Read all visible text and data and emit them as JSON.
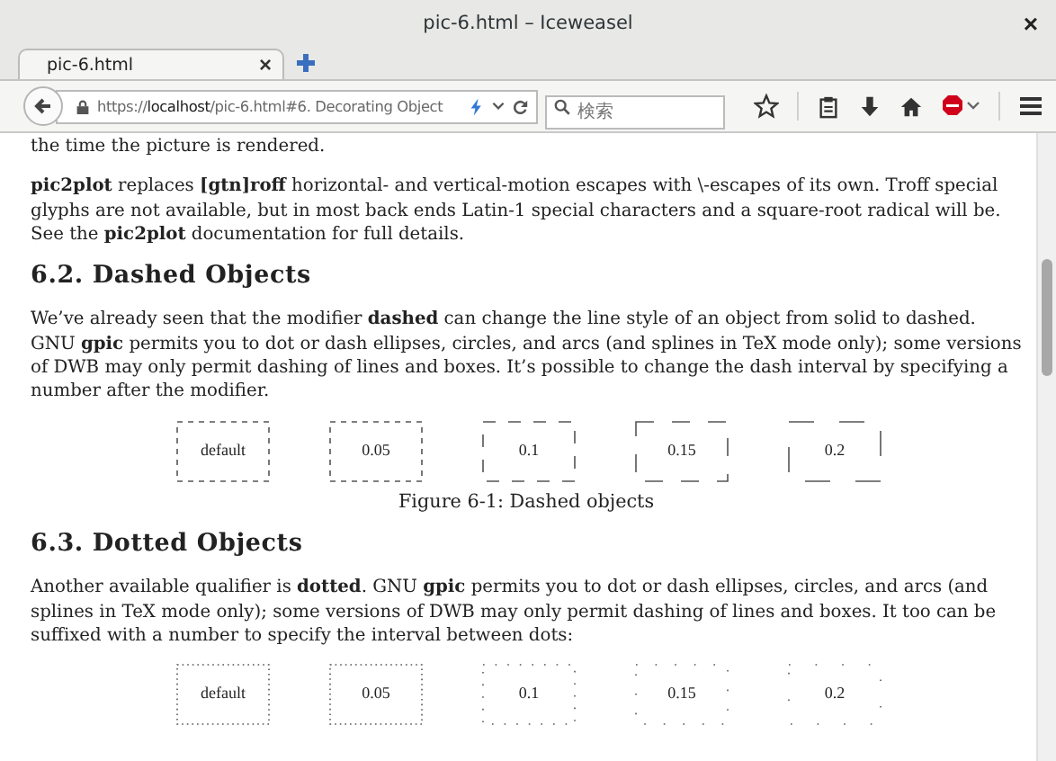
{
  "window": {
    "title": "pic-6.html – Iceweasel",
    "close": "×"
  },
  "tabs": [
    {
      "label": "pic-6.html",
      "selected": true,
      "close": "×"
    }
  ],
  "address": {
    "scheme": "https://",
    "host": "localhost",
    "path": "/pic-6.html#6. Decorating Object"
  },
  "search": {
    "placeholder": "検索"
  },
  "content": [
    {
      "kind": "p",
      "text": "the time the picture is rendered."
    },
    {
      "kind": "p",
      "text": "**pic2plot** replaces **[gtn]roff** horizontal- and vertical-motion escapes with \\-escapes of its own. Troff special glyphs are not available, but in most back ends Latin-1 special characters and a square-root radical will be. See the **pic2plot** documentation for full details."
    },
    {
      "kind": "h",
      "text": "6.2. Dashed Objects"
    },
    {
      "kind": "p",
      "text": "We’ve already seen that the modifier **dashed** can change the line style of an object from solid to dashed. GNU **gpic** permits you to dot or dash ellipses, circles, and arcs (and splines in TeX mode only); some versions of DWB may only permit dashing of lines and boxes. It’s possible to change the dash interval by specifying a number after the modifier."
    },
    {
      "kind": "dashed_figure",
      "boxes": [
        "default",
        "0.05",
        "0.1",
        "0.15",
        "0.2"
      ],
      "caption": "Figure 6-1: Dashed objects"
    },
    {
      "kind": "h",
      "text": "6.3. Dotted Objects"
    },
    {
      "kind": "p",
      "text": "Another available qualifier is **dotted**. GNU **gpic** permits you to dot or dash ellipses, circles, and arcs (and splines in TeX mode only); some versions of DWB may only permit dashing of lines and boxes. It too can be suffixed with a number to specify the interval between dots:"
    },
    {
      "kind": "dotted_figure",
      "boxes": [
        "default",
        "0.05",
        "0.1",
        "0.15",
        "0.2"
      ]
    }
  ]
}
